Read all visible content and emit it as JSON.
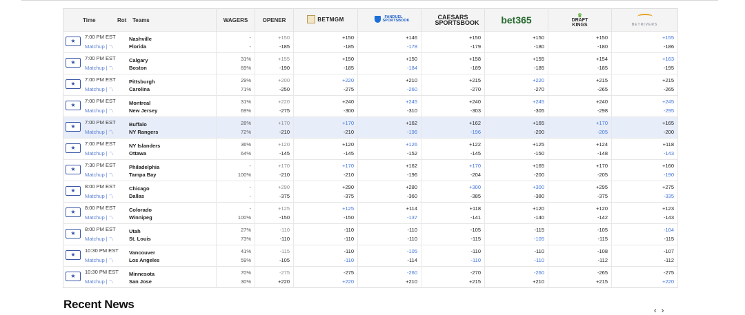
{
  "header": {
    "time": "Time",
    "rot": "Rot",
    "teams": "Teams",
    "wagers": "WAGERS",
    "opener": "OPENER",
    "books": [
      "BETMGM",
      "FANDUEL SPORTSBOOK",
      "CAESARS SPORTSBOOK",
      "bet365",
      "DRAFT KINGS",
      "BETRIVERS"
    ]
  },
  "star_icon": "star-icon",
  "matchup_label": "Matchup",
  "rows": [
    {
      "time": "7:00 PM EST",
      "away": "Nashville",
      "home": "Florida",
      "wagers": [
        "-",
        "-"
      ],
      "opener": [
        "+150",
        "-185"
      ],
      "odds": [
        [
          "+150",
          "-185"
        ],
        [
          "+146",
          "-178"
        ],
        [
          "+150",
          "-179"
        ],
        [
          "+150",
          "-180"
        ],
        [
          "+150",
          "-180"
        ],
        [
          "+155",
          "-186"
        ]
      ],
      "blue": [
        [
          0,
          0
        ],
        [
          0,
          1
        ],
        [
          0,
          0
        ],
        [
          0,
          0
        ],
        [
          0,
          0
        ],
        [
          1,
          0
        ]
      ]
    },
    {
      "time": "7:00 PM EST",
      "away": "Calgary",
      "home": "Boston",
      "wagers": [
        "31%",
        "69%"
      ],
      "opener": [
        "+155",
        "-190"
      ],
      "odds": [
        [
          "+150",
          "-185"
        ],
        [
          "+150",
          "-184"
        ],
        [
          "+158",
          "-189"
        ],
        [
          "+155",
          "-185"
        ],
        [
          "+154",
          "-185"
        ],
        [
          "+163",
          "-195"
        ]
      ],
      "blue": [
        [
          0,
          0
        ],
        [
          0,
          1
        ],
        [
          0,
          0
        ],
        [
          0,
          0
        ],
        [
          0,
          0
        ],
        [
          1,
          0
        ]
      ]
    },
    {
      "time": "7:00 PM EST",
      "away": "Pittsburgh",
      "home": "Carolina",
      "wagers": [
        "29%",
        "71%"
      ],
      "opener": [
        "+200",
        "-250"
      ],
      "odds": [
        [
          "+220",
          "-275"
        ],
        [
          "+210",
          "-260"
        ],
        [
          "+215",
          "-270"
        ],
        [
          "+220",
          "-270"
        ],
        [
          "+215",
          "-265"
        ],
        [
          "+215",
          "-265"
        ]
      ],
      "blue": [
        [
          1,
          0
        ],
        [
          0,
          1
        ],
        [
          0,
          0
        ],
        [
          1,
          0
        ],
        [
          0,
          0
        ],
        [
          0,
          0
        ]
      ]
    },
    {
      "time": "7:00 PM EST",
      "away": "Montreal",
      "home": "New Jersey",
      "wagers": [
        "31%",
        "69%"
      ],
      "opener": [
        "+220",
        "-275"
      ],
      "odds": [
        [
          "+240",
          "-300"
        ],
        [
          "+245",
          "-310"
        ],
        [
          "+240",
          "-303"
        ],
        [
          "+245",
          "-305"
        ],
        [
          "+240",
          "-298"
        ],
        [
          "+245",
          "-295"
        ]
      ],
      "blue": [
        [
          0,
          0
        ],
        [
          1,
          0
        ],
        [
          0,
          0
        ],
        [
          1,
          0
        ],
        [
          0,
          0
        ],
        [
          1,
          1
        ]
      ]
    },
    {
      "time": "7:00 PM EST",
      "away": "Buffalo",
      "home": "NY Rangers",
      "wagers": [
        "28%",
        "72%"
      ],
      "opener": [
        "+170",
        "-210"
      ],
      "odds": [
        [
          "+170",
          "-210"
        ],
        [
          "+162",
          "-196"
        ],
        [
          "+162",
          "-196"
        ],
        [
          "+165",
          "-200"
        ],
        [
          "+170",
          "-205"
        ],
        [
          "+165",
          "-200"
        ]
      ],
      "blue": [
        [
          1,
          0
        ],
        [
          0,
          1
        ],
        [
          0,
          1
        ],
        [
          0,
          0
        ],
        [
          1,
          1
        ],
        [
          0,
          0
        ]
      ],
      "highlight": true
    },
    {
      "time": "7:00 PM EST",
      "away": "NY Islanders",
      "home": "Ottawa",
      "wagers": [
        "36%",
        "64%"
      ],
      "opener": [
        "+120",
        "-145"
      ],
      "odds": [
        [
          "+120",
          "-145"
        ],
        [
          "+126",
          "-152"
        ],
        [
          "+122",
          "-145"
        ],
        [
          "+125",
          "-150"
        ],
        [
          "+124",
          "-148"
        ],
        [
          "+118",
          "-143"
        ]
      ],
      "blue": [
        [
          0,
          0
        ],
        [
          1,
          0
        ],
        [
          0,
          0
        ],
        [
          0,
          0
        ],
        [
          0,
          0
        ],
        [
          0,
          1
        ]
      ]
    },
    {
      "time": "7:30 PM EST",
      "away": "Philadelphia",
      "home": "Tampa Bay",
      "wagers": [
        "-",
        "100%"
      ],
      "opener": [
        "+170",
        "-210"
      ],
      "odds": [
        [
          "+170",
          "-210"
        ],
        [
          "+162",
          "-196"
        ],
        [
          "+170",
          "-204"
        ],
        [
          "+165",
          "-200"
        ],
        [
          "+170",
          "-205"
        ],
        [
          "+160",
          "-190"
        ]
      ],
      "blue": [
        [
          1,
          0
        ],
        [
          0,
          0
        ],
        [
          1,
          0
        ],
        [
          0,
          0
        ],
        [
          0,
          0
        ],
        [
          0,
          1
        ]
      ]
    },
    {
      "time": "8:00 PM EST",
      "away": "Chicago",
      "home": "Dallas",
      "wagers": [
        "-",
        "-"
      ],
      "opener": [
        "+290",
        "-375"
      ],
      "odds": [
        [
          "+290",
          "-375"
        ],
        [
          "+280",
          "-360"
        ],
        [
          "+300",
          "-385"
        ],
        [
          "+300",
          "-380"
        ],
        [
          "+295",
          "-375"
        ],
        [
          "+275",
          "-335"
        ]
      ],
      "blue": [
        [
          0,
          0
        ],
        [
          0,
          0
        ],
        [
          1,
          0
        ],
        [
          1,
          0
        ],
        [
          0,
          0
        ],
        [
          0,
          1
        ]
      ]
    },
    {
      "time": "8:00 PM EST",
      "away": "Colorado",
      "home": "Winnipeg",
      "wagers": [
        "-",
        "100%"
      ],
      "opener": [
        "+125",
        "-150"
      ],
      "odds": [
        [
          "+125",
          "-150"
        ],
        [
          "+114",
          "-137"
        ],
        [
          "+118",
          "-141"
        ],
        [
          "+120",
          "-140"
        ],
        [
          "+120",
          "-142"
        ],
        [
          "+123",
          "-143"
        ]
      ],
      "blue": [
        [
          1,
          0
        ],
        [
          0,
          1
        ],
        [
          0,
          0
        ],
        [
          0,
          0
        ],
        [
          0,
          0
        ],
        [
          0,
          0
        ]
      ]
    },
    {
      "time": "8:00 PM EST",
      "away": "Utah",
      "home": "St. Louis",
      "wagers": [
        "27%",
        "73%"
      ],
      "opener": [
        "-110",
        "-110"
      ],
      "odds": [
        [
          "-110",
          "-110"
        ],
        [
          "-110",
          "-110"
        ],
        [
          "-105",
          "-115"
        ],
        [
          "-115",
          "-105"
        ],
        [
          "-105",
          "-115"
        ],
        [
          "-104",
          "-115"
        ]
      ],
      "blue": [
        [
          0,
          0
        ],
        [
          0,
          0
        ],
        [
          0,
          0
        ],
        [
          0,
          1
        ],
        [
          0,
          0
        ],
        [
          1,
          0
        ]
      ]
    },
    {
      "time": "10:30 PM EST",
      "away": "Vancouver",
      "home": "Los Angeles",
      "wagers": [
        "41%",
        "59%"
      ],
      "opener": [
        "-115",
        "-105"
      ],
      "odds": [
        [
          "-110",
          "-110"
        ],
        [
          "-105",
          "-114"
        ],
        [
          "-110",
          "-110"
        ],
        [
          "-110",
          "-110"
        ],
        [
          "-108",
          "-112"
        ],
        [
          "-107",
          "-112"
        ]
      ],
      "blue": [
        [
          0,
          1
        ],
        [
          1,
          0
        ],
        [
          0,
          1
        ],
        [
          0,
          1
        ],
        [
          0,
          0
        ],
        [
          0,
          0
        ]
      ]
    },
    {
      "time": "10:30 PM EST",
      "away": "Minnesota",
      "home": "San Jose",
      "wagers": [
        "70%",
        "30%"
      ],
      "opener": [
        "-275",
        "+220"
      ],
      "odds": [
        [
          "-275",
          "+220"
        ],
        [
          "-260",
          "+210"
        ],
        [
          "-270",
          "+215"
        ],
        [
          "-260",
          "+210"
        ],
        [
          "-265",
          "+215"
        ],
        [
          "-275",
          "+220"
        ]
      ],
      "blue": [
        [
          0,
          1
        ],
        [
          1,
          0
        ],
        [
          0,
          0
        ],
        [
          1,
          0
        ],
        [
          0,
          0
        ],
        [
          0,
          1
        ]
      ]
    }
  ],
  "news": {
    "title": "Recent News",
    "prev": "‹",
    "next": "›"
  },
  "colors": {
    "accent_blue": "#3f73d9",
    "highlight_row": "#e7edf9",
    "star_border": "#3a57a8"
  }
}
